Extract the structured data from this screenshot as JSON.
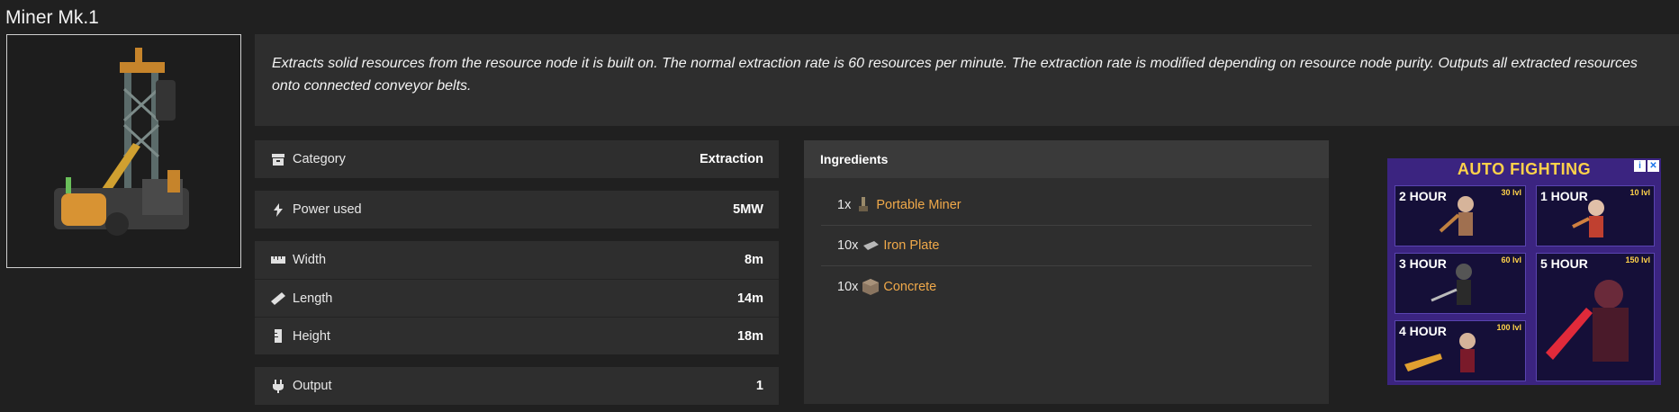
{
  "page": {
    "title": "Miner Mk.1"
  },
  "description": "Extracts solid resources from the resource node it is built on. The normal extraction rate is 60 resources per minute. The extraction rate is modified depending on resource node purity. Outputs all extracted resources onto connected conveyor belts.",
  "properties": {
    "category": {
      "label": "Category",
      "value": "Extraction",
      "icon": "archive-icon"
    },
    "power": {
      "label": "Power used",
      "value": "5MW",
      "icon": "lightning-icon"
    },
    "width": {
      "label": "Width",
      "value": "8m",
      "icon": "ruler-icon"
    },
    "length": {
      "label": "Length",
      "value": "14m",
      "icon": "ruler-diagonal-icon"
    },
    "height": {
      "label": "Height",
      "value": "18m",
      "icon": "ruler-vertical-icon"
    },
    "output": {
      "label": "Output",
      "value": "1",
      "icon": "plug-icon"
    }
  },
  "ingredients": {
    "title": "Ingredients",
    "items": [
      {
        "qty": "1x",
        "name": "Portable Miner"
      },
      {
        "qty": "10x",
        "name": "Iron Plate"
      },
      {
        "qty": "10x",
        "name": "Concrete"
      }
    ]
  },
  "ad": {
    "title": "AUTO FIGHTING",
    "cards": [
      {
        "time": "2 HOUR",
        "level": "30 lvl"
      },
      {
        "time": "1 HOUR",
        "level": "10 lvl"
      },
      {
        "time": "3 HOUR",
        "level": "60 lvl"
      },
      {
        "time": "5 HOUR",
        "level": "150 lvl"
      },
      {
        "time": "4 HOUR",
        "level": "100 lvl"
      }
    ],
    "info_glyph": "i",
    "close_glyph": "✕"
  },
  "colors": {
    "link": "#f0a94a",
    "panel": "#2e2e2e",
    "background": "#202020"
  }
}
